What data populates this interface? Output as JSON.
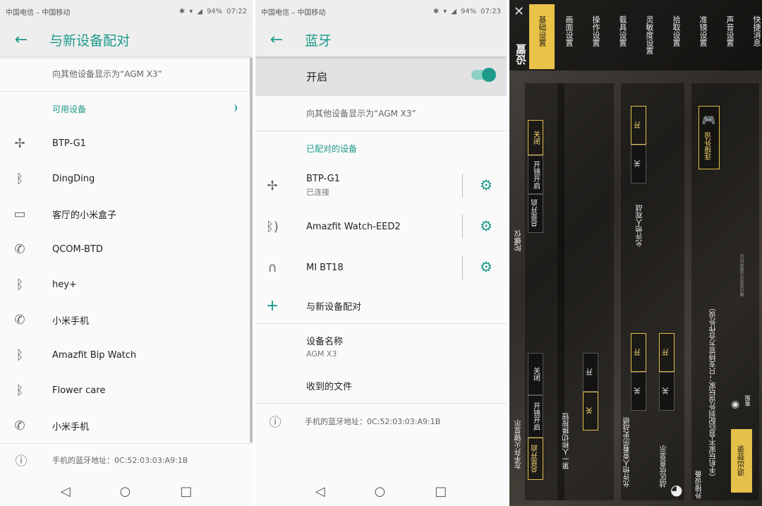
{
  "status1": {
    "carrier": "中国电信 – 中国移动",
    "battery": "94%",
    "time": "07:22"
  },
  "status2": {
    "carrier": "中国电信 – 中国移动",
    "battery": "94%",
    "time": "07:23"
  },
  "pair_screen": {
    "title": "与新设备配对",
    "visible_as": "向其他设备显示为“AGM X3”",
    "section": "可用设备",
    "devices": [
      {
        "icon": "gamepad-icon",
        "name": "BTP-G1"
      },
      {
        "icon": "bluetooth-icon",
        "name": "DingDing"
      },
      {
        "icon": "laptop-icon",
        "name": "客厅的小米盒子"
      },
      {
        "icon": "phone-icon",
        "name": "QCOM-BTD"
      },
      {
        "icon": "bluetooth-icon",
        "name": "hey+"
      },
      {
        "icon": "phone-icon",
        "name": "小米手机"
      },
      {
        "icon": "bluetooth-icon",
        "name": "Amazfit Bip Watch"
      },
      {
        "icon": "bluetooth-icon",
        "name": "Flower care"
      },
      {
        "icon": "phone-icon",
        "name": "小米手机"
      }
    ],
    "bt_address": "手机的蓝牙地址：0C:52:03:03:A9:1B"
  },
  "bt_screen": {
    "title": "蓝牙",
    "toggle_label": "开启",
    "toggle_on": true,
    "visible_as": "向其他设备显示为“AGM X3”",
    "section": "已配对的设备",
    "paired": [
      {
        "icon": "gamepad-icon",
        "name": "BTP-G1",
        "sub": "已连接"
      },
      {
        "icon": "bluetooth-audio-icon",
        "name": "Amazfit Watch-EED2",
        "sub": ""
      },
      {
        "icon": "headset-icon",
        "name": "MI BT18",
        "sub": ""
      }
    ],
    "pair_new": "与新设备配对",
    "device_name_label": "设备名称",
    "device_name_value": "AGM X3",
    "received_files": "收到的文件",
    "bt_address": "手机的蓝牙地址：0C:52:03:03:A9:1B"
  },
  "game": {
    "title": "设置",
    "tabs": [
      "基础设置",
      "画面设置",
      "操作设置",
      "载具设置",
      "灵敏度设置",
      "拾取设置",
      "准镜设置",
      "声音设置",
      "快捷消息"
    ],
    "left_fire": {
      "label": "左手开火键显示",
      "options": [
        "总是开启",
        "开镜开启",
        "关闭"
      ]
    },
    "gyro": {
      "label": "陀螺仪",
      "options": [
        "总是开启",
        "开镜开启",
        "关闭"
      ]
    },
    "fpp_switch": {
      "label": "第一人称切换按钮",
      "options": [
        "关",
        "开"
      ]
    },
    "allow_view_history": {
      "label": "允许他人查看历史战绩",
      "options": [
        "关",
        "开"
      ]
    },
    "allow_spectate": {
      "label": "允许他人观战",
      "options": [
        "关",
        "开"
      ]
    },
    "battle_info": {
      "label": "战区信息显示",
      "options": [
        "关",
        "开"
      ]
    },
    "controller": {
      "label": "外接设备",
      "note": "（手机玩家不会匹配到外设玩家；只支持官方合作外设）",
      "connect": "连接外设",
      "small_note": "腾讯游戏外设服务协议"
    },
    "logout": "退出登录",
    "feedback": "客服"
  }
}
